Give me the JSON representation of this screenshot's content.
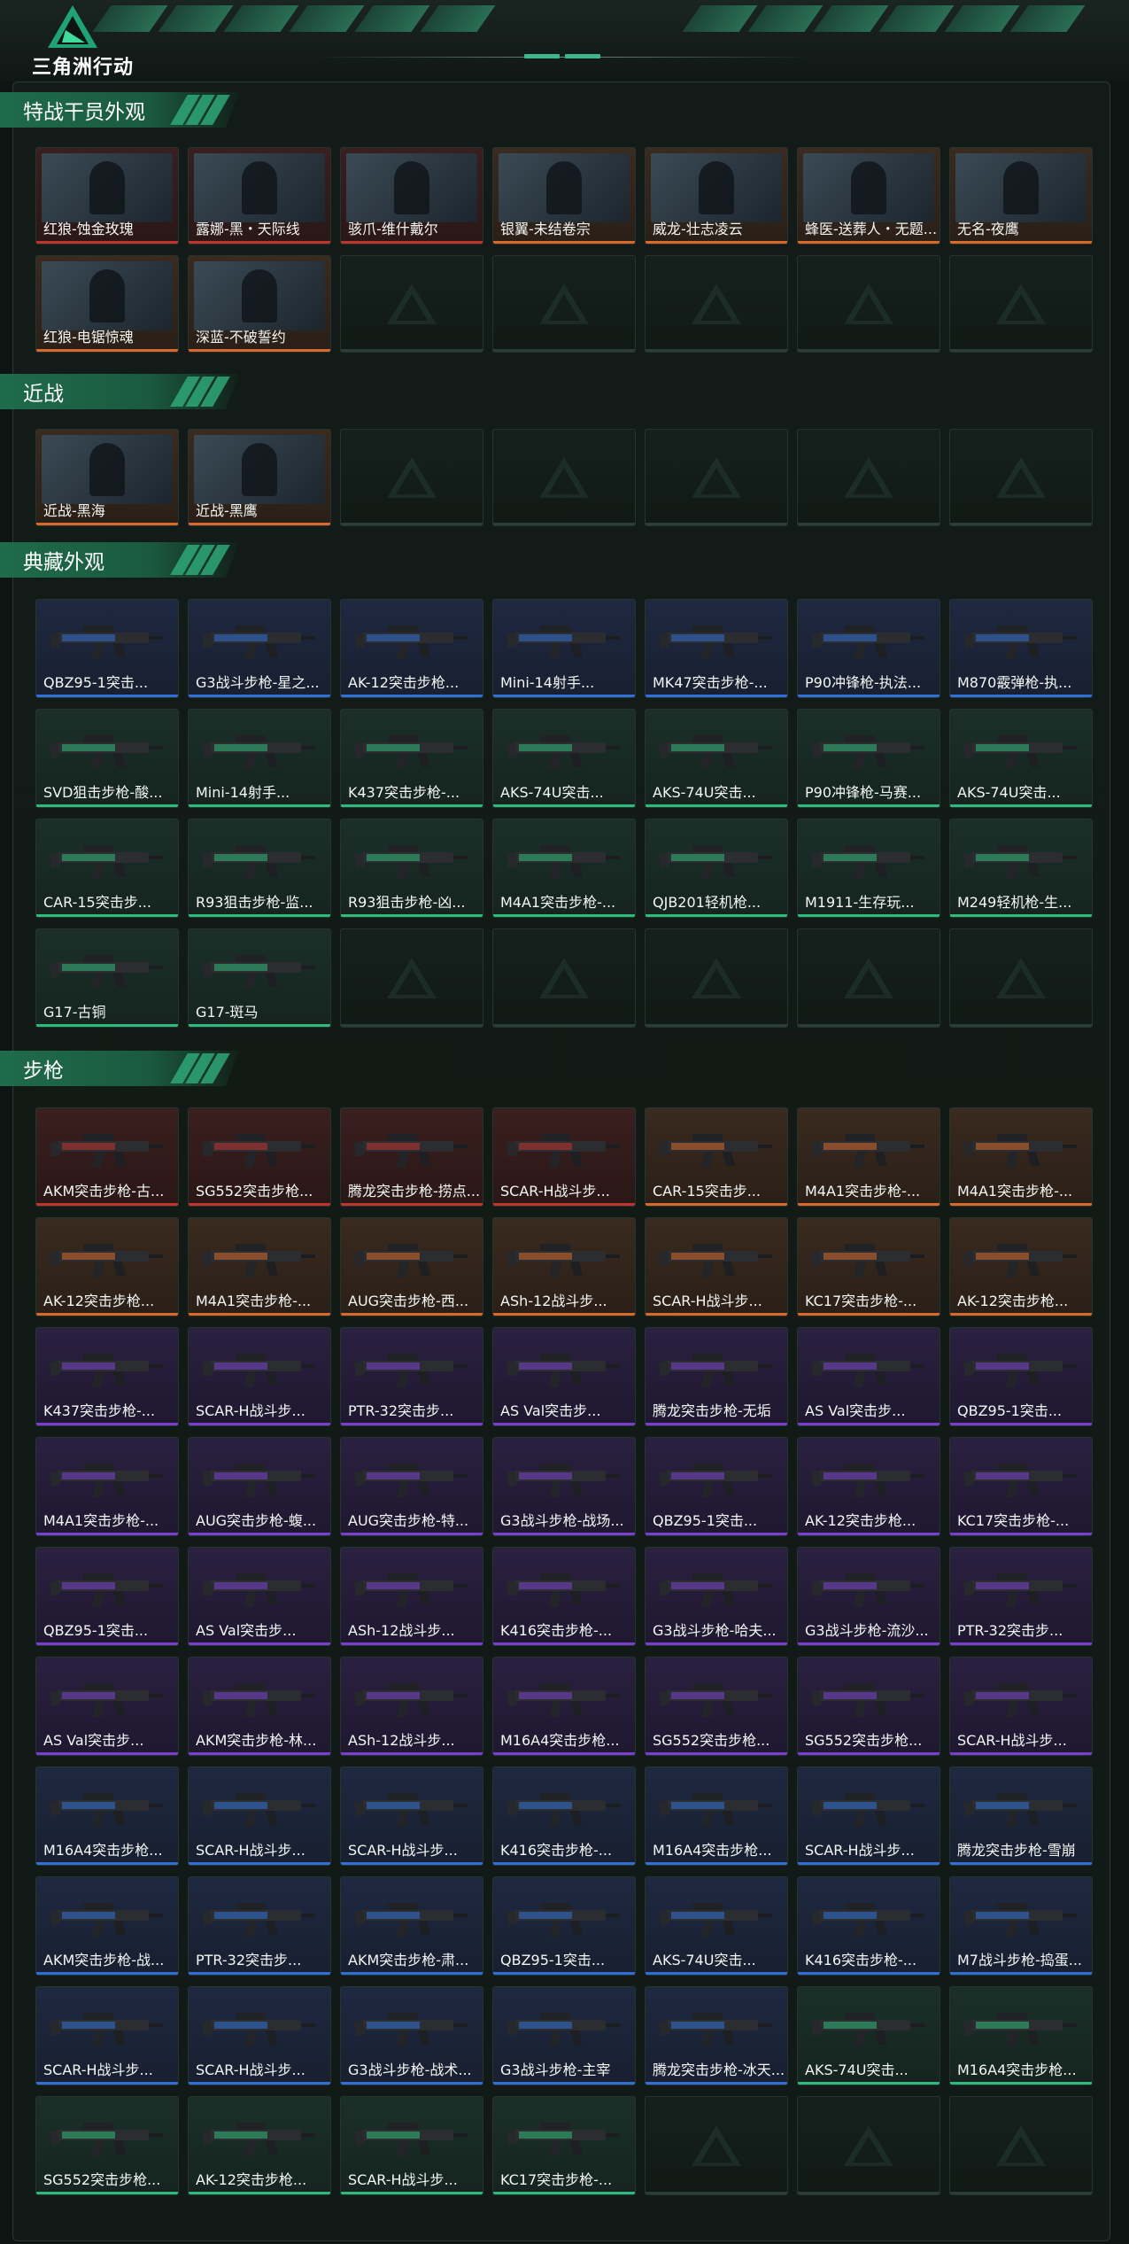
{
  "app": {
    "logo_text": "三角洲行动"
  },
  "colors": {
    "orange": "#d9682a",
    "red": "#c2332e",
    "blue": "#2f6fd6",
    "purple": "#7b3fcf",
    "green": "#2fb97c",
    "empty": "#2c3d37"
  },
  "sections": {
    "operators": {
      "title": "特战干员外观",
      "items": [
        {
          "label": "红狼-蚀金玫瑰",
          "rarity": "red"
        },
        {
          "label": "露娜-黑・天际线",
          "rarity": "red"
        },
        {
          "label": "骇爪-维什戴尔",
          "rarity": "red"
        },
        {
          "label": "银翼-未结卷宗",
          "rarity": "orange"
        },
        {
          "label": "威龙-壮志凌云",
          "rarity": "orange"
        },
        {
          "label": "蜂医-送葬人・无题...",
          "rarity": "orange"
        },
        {
          "label": "无名-夜鹰",
          "rarity": "orange"
        },
        {
          "label": "红狼-电锯惊魂",
          "rarity": "orange"
        },
        {
          "label": "深蓝-不破誓约",
          "rarity": "orange"
        }
      ]
    },
    "melee": {
      "title": "近战",
      "items": [
        {
          "label": "近战-黑海",
          "rarity": "orange"
        },
        {
          "label": "近战-黑鹰",
          "rarity": "orange"
        }
      ]
    },
    "collection": {
      "title": "典藏外观",
      "items": [
        {
          "label": "QBZ95-1突击...",
          "rarity": "blue"
        },
        {
          "label": "G3战斗步枪-星之...",
          "rarity": "blue"
        },
        {
          "label": "AK-12突击步枪...",
          "rarity": "blue"
        },
        {
          "label": "Mini-14射手...",
          "rarity": "blue"
        },
        {
          "label": "MK47突击步枪-...",
          "rarity": "blue"
        },
        {
          "label": "P90冲锋枪-执法...",
          "rarity": "blue"
        },
        {
          "label": "M870霰弹枪-执...",
          "rarity": "blue"
        },
        {
          "label": "SVD狙击步枪-酸...",
          "rarity": "green"
        },
        {
          "label": "Mini-14射手...",
          "rarity": "green"
        },
        {
          "label": "K437突击步枪-...",
          "rarity": "green"
        },
        {
          "label": "AKS-74U突击...",
          "rarity": "green"
        },
        {
          "label": "AKS-74U突击...",
          "rarity": "green"
        },
        {
          "label": "P90冲锋枪-马赛...",
          "rarity": "green"
        },
        {
          "label": "AKS-74U突击...",
          "rarity": "green"
        },
        {
          "label": "CAR-15突击步...",
          "rarity": "green"
        },
        {
          "label": "R93狙击步枪-监...",
          "rarity": "green"
        },
        {
          "label": "R93狙击步枪-凶...",
          "rarity": "green"
        },
        {
          "label": "M4A1突击步枪-...",
          "rarity": "green"
        },
        {
          "label": "QJB201轻机枪...",
          "rarity": "green"
        },
        {
          "label": "M1911-生存玩...",
          "rarity": "green"
        },
        {
          "label": "M249轻机枪-生...",
          "rarity": "green"
        },
        {
          "label": "G17-古铜",
          "rarity": "green"
        },
        {
          "label": "G17-斑马",
          "rarity": "green"
        }
      ]
    },
    "rifles": {
      "title": "步枪",
      "items": [
        {
          "label": "AKM突击步枪-古...",
          "rarity": "red"
        },
        {
          "label": "SG552突击步枪...",
          "rarity": "red"
        },
        {
          "label": "腾龙突击步枪-捞点...",
          "rarity": "red"
        },
        {
          "label": "SCAR-H战斗步...",
          "rarity": "red"
        },
        {
          "label": "CAR-15突击步...",
          "rarity": "orange"
        },
        {
          "label": "M4A1突击步枪-...",
          "rarity": "orange"
        },
        {
          "label": "M4A1突击步枪-...",
          "rarity": "orange"
        },
        {
          "label": "AK-12突击步枪...",
          "rarity": "orange"
        },
        {
          "label": "M4A1突击步枪-...",
          "rarity": "orange"
        },
        {
          "label": "AUG突击步枪-西...",
          "rarity": "orange"
        },
        {
          "label": "ASh-12战斗步...",
          "rarity": "orange"
        },
        {
          "label": "SCAR-H战斗步...",
          "rarity": "orange"
        },
        {
          "label": "KC17突击步枪-...",
          "rarity": "orange"
        },
        {
          "label": "AK-12突击步枪...",
          "rarity": "orange"
        },
        {
          "label": "K437突击步枪-...",
          "rarity": "purple"
        },
        {
          "label": "SCAR-H战斗步...",
          "rarity": "purple"
        },
        {
          "label": "PTR-32突击步...",
          "rarity": "purple"
        },
        {
          "label": "AS Val突击步...",
          "rarity": "purple"
        },
        {
          "label": "腾龙突击步枪-无垢",
          "rarity": "purple"
        },
        {
          "label": "AS Val突击步...",
          "rarity": "purple"
        },
        {
          "label": "QBZ95-1突击...",
          "rarity": "purple"
        },
        {
          "label": "M4A1突击步枪-...",
          "rarity": "purple"
        },
        {
          "label": "AUG突击步枪-蝮...",
          "rarity": "purple"
        },
        {
          "label": "AUG突击步枪-特...",
          "rarity": "purple"
        },
        {
          "label": "G3战斗步枪-战场...",
          "rarity": "purple"
        },
        {
          "label": "QBZ95-1突击...",
          "rarity": "purple"
        },
        {
          "label": "AK-12突击步枪...",
          "rarity": "purple"
        },
        {
          "label": "KC17突击步枪-...",
          "rarity": "purple"
        },
        {
          "label": "QBZ95-1突击...",
          "rarity": "purple"
        },
        {
          "label": "AS Val突击步...",
          "rarity": "purple"
        },
        {
          "label": "ASh-12战斗步...",
          "rarity": "purple"
        },
        {
          "label": "K416突击步枪-...",
          "rarity": "purple"
        },
        {
          "label": "G3战斗步枪-哈夫...",
          "rarity": "purple"
        },
        {
          "label": "G3战斗步枪-流沙...",
          "rarity": "purple"
        },
        {
          "label": "PTR-32突击步...",
          "rarity": "purple"
        },
        {
          "label": "AS Val突击步...",
          "rarity": "purple"
        },
        {
          "label": "AKM突击步枪-林...",
          "rarity": "purple"
        },
        {
          "label": "ASh-12战斗步...",
          "rarity": "purple"
        },
        {
          "label": "M16A4突击步枪...",
          "rarity": "purple"
        },
        {
          "label": "SG552突击步枪...",
          "rarity": "purple"
        },
        {
          "label": "SG552突击步枪...",
          "rarity": "purple"
        },
        {
          "label": "SCAR-H战斗步...",
          "rarity": "purple"
        },
        {
          "label": "M16A4突击步枪...",
          "rarity": "blue"
        },
        {
          "label": "SCAR-H战斗步...",
          "rarity": "blue"
        },
        {
          "label": "SCAR-H战斗步...",
          "rarity": "blue"
        },
        {
          "label": "K416突击步枪-...",
          "rarity": "blue"
        },
        {
          "label": "M16A4突击步枪...",
          "rarity": "blue"
        },
        {
          "label": "SCAR-H战斗步...",
          "rarity": "blue"
        },
        {
          "label": "腾龙突击步枪-雪崩",
          "rarity": "blue"
        },
        {
          "label": "AKM突击步枪-战...",
          "rarity": "blue"
        },
        {
          "label": "PTR-32突击步...",
          "rarity": "blue"
        },
        {
          "label": "AKM突击步枪-肃...",
          "rarity": "blue"
        },
        {
          "label": "QBZ95-1突击...",
          "rarity": "blue"
        },
        {
          "label": "AKS-74U突击...",
          "rarity": "blue"
        },
        {
          "label": "K416突击步枪-...",
          "rarity": "blue"
        },
        {
          "label": "M7战斗步枪-捣蛋...",
          "rarity": "blue"
        },
        {
          "label": "SCAR-H战斗步...",
          "rarity": "blue"
        },
        {
          "label": "SCAR-H战斗步...",
          "rarity": "blue"
        },
        {
          "label": "G3战斗步枪-战术...",
          "rarity": "blue"
        },
        {
          "label": "G3战斗步枪-主宰",
          "rarity": "blue"
        },
        {
          "label": "腾龙突击步枪-冰天...",
          "rarity": "blue"
        },
        {
          "label": "AKS-74U突击...",
          "rarity": "green"
        },
        {
          "label": "M16A4突击步枪...",
          "rarity": "green"
        },
        {
          "label": "SG552突击步枪...",
          "rarity": "green"
        },
        {
          "label": "AK-12突击步枪...",
          "rarity": "green"
        },
        {
          "label": "SCAR-H战斗步...",
          "rarity": "green"
        },
        {
          "label": "KC17突击步枪-...",
          "rarity": "green"
        }
      ]
    }
  }
}
